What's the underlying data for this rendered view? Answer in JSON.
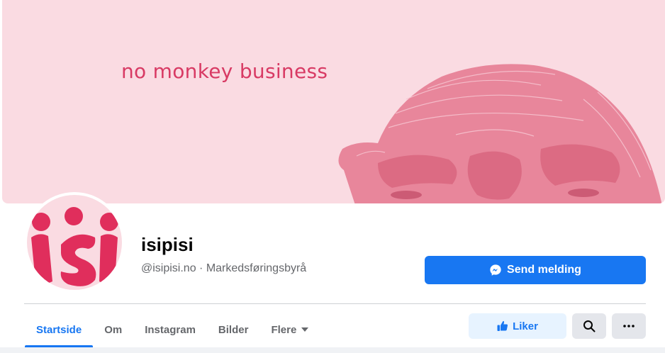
{
  "cover": {
    "tagline": "no monkey business",
    "colors": {
      "background": "#fadbe2",
      "text": "#d83a64",
      "illustration": "#e57a92"
    }
  },
  "profile": {
    "logo_text": "isi",
    "name": "isipisi",
    "subtitle": "@isipisi.no · Markedsføringsbyrå"
  },
  "actions": {
    "send_message": "Send melding",
    "like": "Liker",
    "search_icon": "search-icon",
    "more_icon": "more-horizontal-icon"
  },
  "tabs": [
    {
      "label": "Startside",
      "active": true
    },
    {
      "label": "Om",
      "active": false
    },
    {
      "label": "Instagram",
      "active": false
    },
    {
      "label": "Bilder",
      "active": false
    },
    {
      "label": "Flere",
      "active": false,
      "has_dropdown": true
    }
  ],
  "colors": {
    "accent": "#1877f2",
    "accent_light": "#e7f3ff",
    "secondary_button": "#e4e6eb",
    "text_primary": "#050505",
    "text_secondary": "#65676b"
  }
}
